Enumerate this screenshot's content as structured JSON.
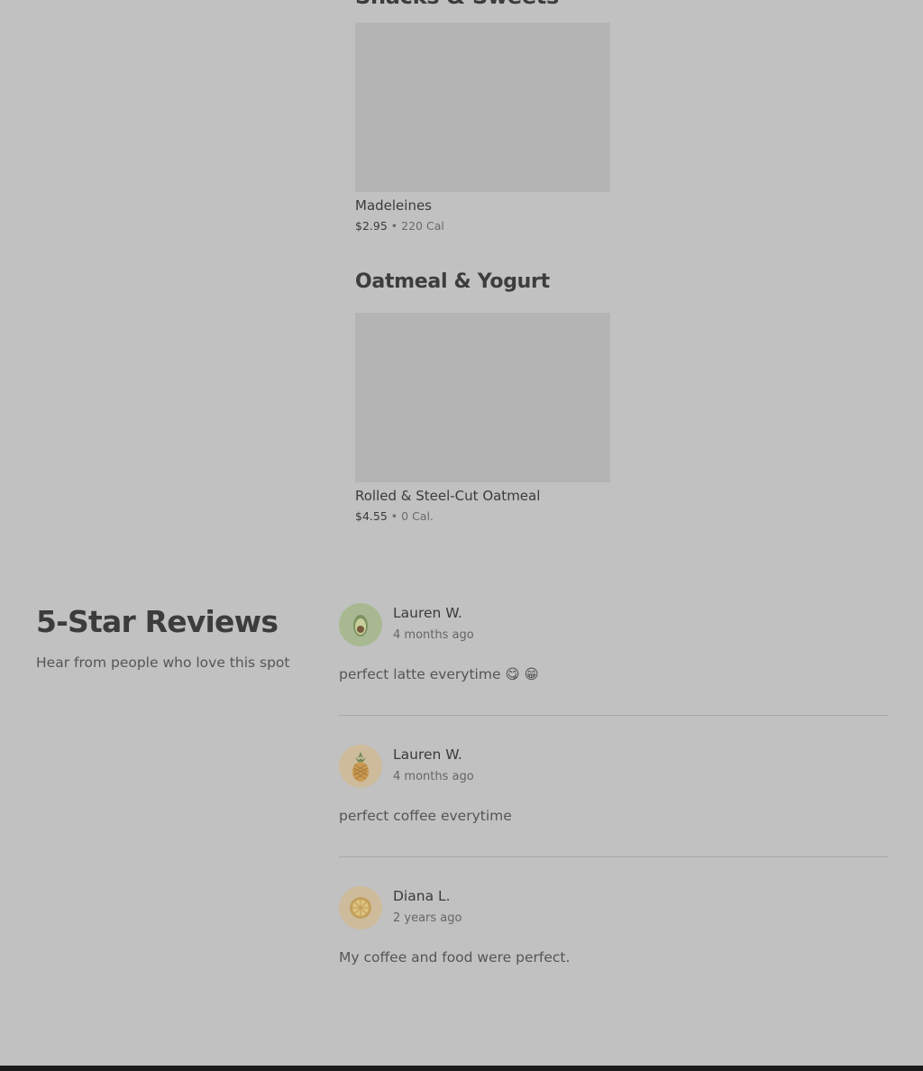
{
  "menu": {
    "cut_section_title": "Snacks & Sweets",
    "sections": [
      {
        "items": [
          {
            "name": "Madeleines",
            "price": "$2.95",
            "separator": "•",
            "calories": "220 Cal"
          }
        ]
      },
      {
        "title": "Oatmeal & Yogurt",
        "items": [
          {
            "name": "Rolled & Steel-Cut Oatmeal",
            "price": "$4.55",
            "separator": "•",
            "calories": "0 Cal."
          }
        ]
      }
    ]
  },
  "reviews": {
    "heading": "5-Star Reviews",
    "subheading": "Hear from people who love this spot",
    "items": [
      {
        "name": "Lauren W.",
        "date": "4 months ago",
        "text": "perfect latte everytime 😋 😁",
        "avatar_icon": "avocado-icon",
        "avatar_color": "#a8b991"
      },
      {
        "name": "Lauren W.",
        "date": "4 months ago",
        "text": "perfect coffee everytime",
        "avatar_icon": "pineapple-icon",
        "avatar_color": "#cdbb9b"
      },
      {
        "name": "Diana L.",
        "date": "2 years ago",
        "text": "My coffee and food were perfect.",
        "avatar_icon": "lemon-icon",
        "avatar_color": "#cdbb9b"
      }
    ]
  },
  "colors": {
    "overlay_background": "#c1c1c1",
    "thumbnail_placeholder": "#b4b4b4"
  }
}
